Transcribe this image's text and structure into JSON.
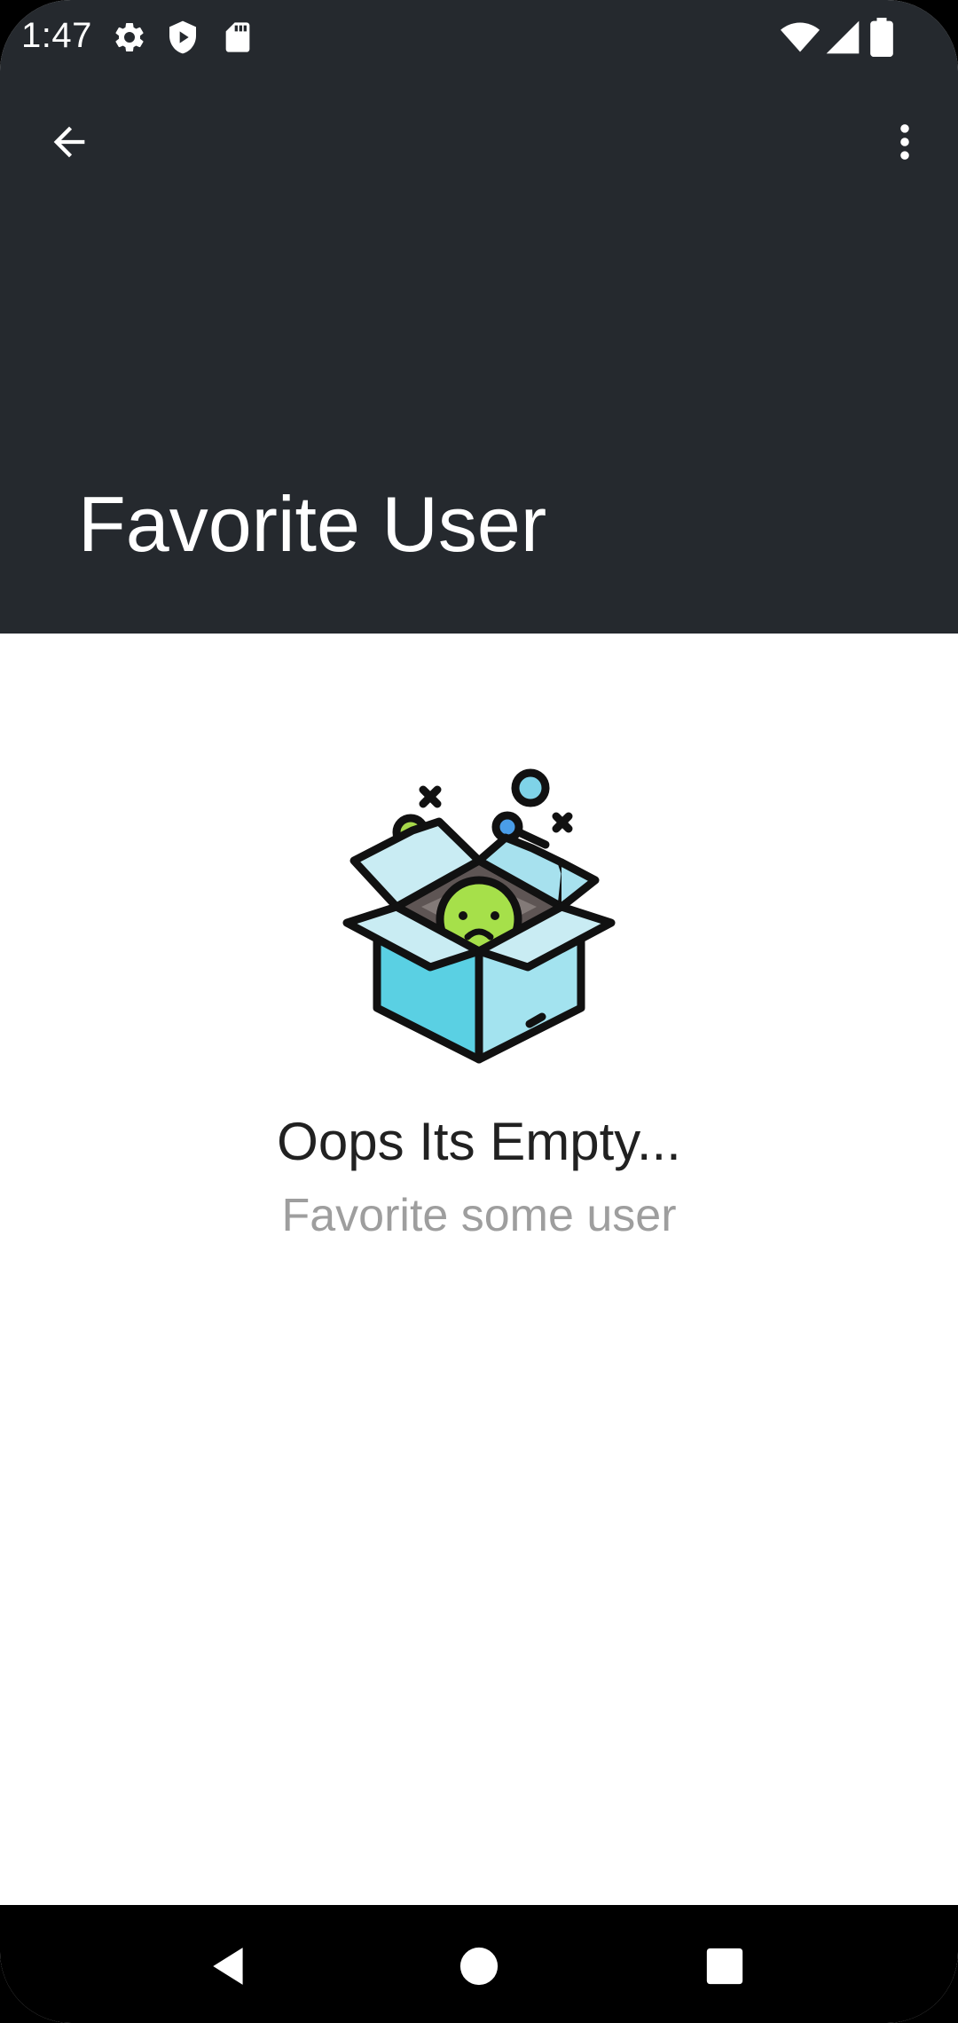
{
  "status_bar": {
    "time": "1:47",
    "left_icons": [
      "settings-icon",
      "shield-icon",
      "play-protect-icon",
      "sd-card-icon"
    ],
    "right_icons": [
      "wifi-icon",
      "cellular-signal-icon",
      "battery-icon"
    ]
  },
  "app_bar": {
    "back_icon": "arrow-back-icon",
    "menu_icon": "more-vert-icon",
    "title": "Favorite User",
    "background_color": "#25292e"
  },
  "empty_state": {
    "illustration": "sad-face-in-open-box",
    "title": "Oops Its Empty...",
    "subtitle": "Favorite some user"
  },
  "navigation_bar": {
    "buttons": [
      "back-triangle-icon",
      "home-circle-icon",
      "recents-square-icon"
    ]
  }
}
